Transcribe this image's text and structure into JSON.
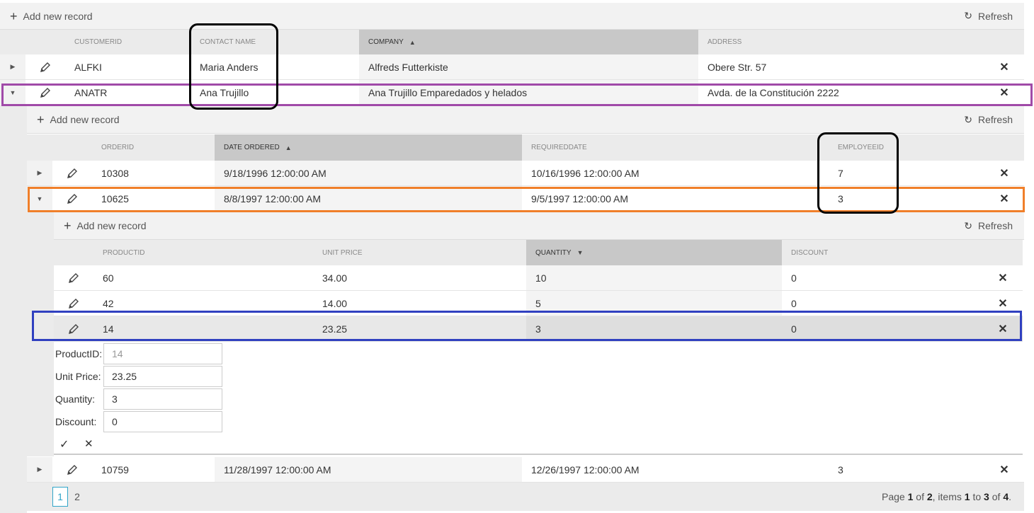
{
  "toolbar": {
    "add_label": "Add new record",
    "refresh_label": "Refresh"
  },
  "customers": {
    "columns": [
      "CUSTOMERID",
      "CONTACT NAME",
      "COMPANY",
      "ADDRESS"
    ],
    "sorted_column": "COMPANY",
    "rows": [
      {
        "customerid": "ALFKI",
        "contact": "Maria Anders",
        "company": "Alfreds Futterkiste",
        "address": "Obere Str. 57"
      },
      {
        "customerid": "ANATR",
        "contact": "Ana Trujillo",
        "company": "Ana Trujillo Emparedados y helados",
        "address": "Avda. de la Constitución 2222"
      }
    ]
  },
  "orders": {
    "columns": [
      "ORDERID",
      "DATE ORDERED",
      "REQUIREDDATE",
      "EMPLOYEEID"
    ],
    "sorted_column": "DATE ORDERED",
    "rows": [
      {
        "orderid": "10308",
        "date": "9/18/1996 12:00:00 AM",
        "required": "10/16/1996 12:00:00 AM",
        "employee": "7"
      },
      {
        "orderid": "10625",
        "date": "8/8/1997 12:00:00 AM",
        "required": "9/5/1997 12:00:00 AM",
        "employee": "3"
      },
      {
        "orderid": "10759",
        "date": "11/28/1997 12:00:00 AM",
        "required": "12/26/1997 12:00:00 AM",
        "employee": "3"
      }
    ]
  },
  "details": {
    "columns": [
      "PRODUCTID",
      "UNIT PRICE",
      "QUANTITY",
      "DISCOUNT"
    ],
    "sorted_column": "QUANTITY",
    "rows": [
      {
        "productid": "60",
        "price": "34.00",
        "quantity": "10",
        "discount": "0"
      },
      {
        "productid": "42",
        "price": "14.00",
        "quantity": "5",
        "discount": "0"
      },
      {
        "productid": "14",
        "price": "23.25",
        "quantity": "3",
        "discount": "0"
      }
    ]
  },
  "edit_form": {
    "productid_label": "ProductID:",
    "productid_value": "14",
    "price_label": "Unit Price:",
    "price_value": "23.25",
    "quantity_label": "Quantity:",
    "quantity_value": "3",
    "discount_label": "Discount:",
    "discount_value": "0"
  },
  "pager": {
    "pages": [
      "1",
      "2"
    ],
    "current": "1",
    "info_prefix": "Page ",
    "page": "1",
    "of1": " of ",
    "total_pages": "2",
    "items_prefix": ", items ",
    "from": "1",
    "to_word": " to ",
    "to": "3",
    "of2": " of ",
    "total_items": "4",
    "suffix": "."
  },
  "colors": {
    "purple": "#a04aa8",
    "orange": "#f07f2a",
    "blue": "#3040c0",
    "black": "#000000",
    "pager_accent": "#31a5c9"
  },
  "icons": {
    "expand": "triangle-right-icon",
    "collapse": "triangle-down-icon",
    "edit": "pencil-icon",
    "delete": "close-icon",
    "refresh": "refresh-icon",
    "add": "plus-icon",
    "update": "check-icon",
    "cancel": "close-icon"
  }
}
